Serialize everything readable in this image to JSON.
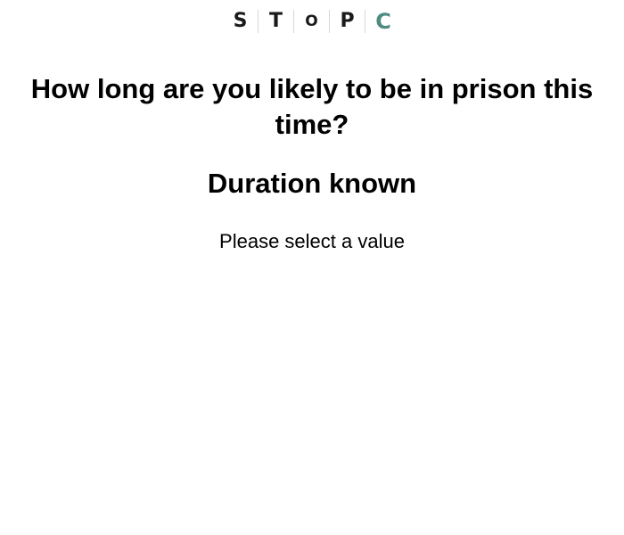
{
  "logo": {
    "letters": [
      "S",
      "T",
      "O",
      "P",
      "C"
    ],
    "accent_color": "#4f8b80"
  },
  "question": {
    "text": "How long are you likely to be in prison this time?"
  },
  "subheading": {
    "text": "Duration known"
  },
  "prompt": {
    "text": "Please select a value"
  }
}
